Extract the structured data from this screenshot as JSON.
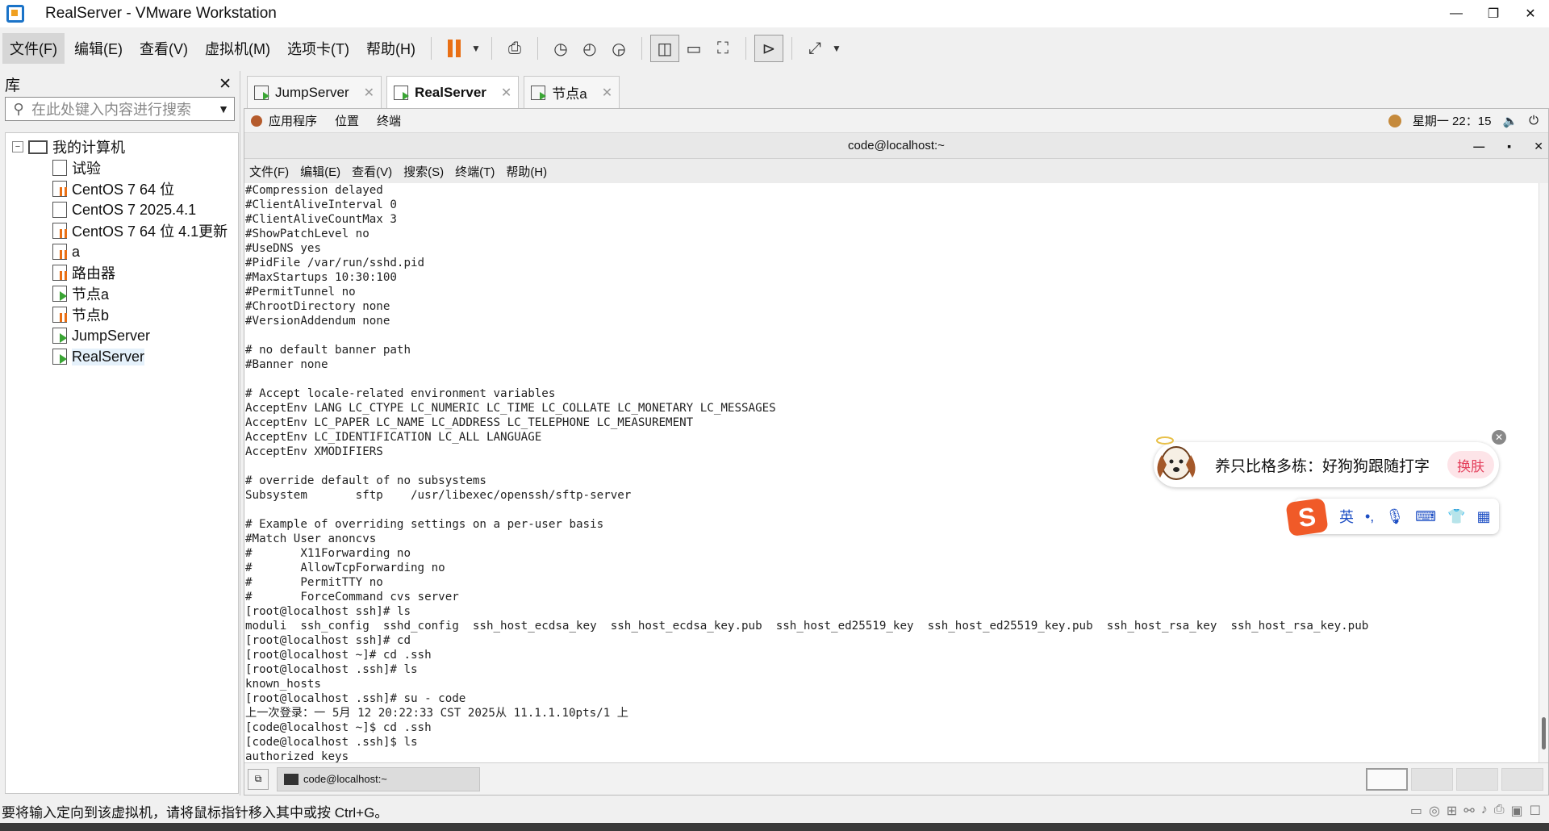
{
  "window": {
    "title": "RealServer - VMware Workstation",
    "controls": [
      "—",
      "❐",
      "✕"
    ]
  },
  "menubar": {
    "items": [
      "文件(F)",
      "编辑(E)",
      "查看(V)",
      "虚拟机(M)",
      "选项卡(T)",
      "帮助(H)"
    ]
  },
  "library": {
    "title": "库",
    "close": "✕",
    "search_placeholder": "在此处键入内容进行搜索",
    "root": "我的计算机",
    "vms": [
      {
        "name": "试验",
        "state": "off"
      },
      {
        "name": "CentOS 7 64 位",
        "state": "paused"
      },
      {
        "name": "CentOS 7 2025.4.1",
        "state": "off"
      },
      {
        "name": "CentOS 7 64 位 4.1更新",
        "state": "paused"
      },
      {
        "name": "a",
        "state": "paused"
      },
      {
        "name": "路由器",
        "state": "paused"
      },
      {
        "name": "节点a",
        "state": "running"
      },
      {
        "name": "节点b",
        "state": "paused"
      },
      {
        "name": "JumpServer",
        "state": "running"
      },
      {
        "name": "RealServer",
        "state": "running"
      }
    ]
  },
  "tabs": [
    {
      "label": "JumpServer",
      "active": false
    },
    {
      "label": "RealServer",
      "active": true
    },
    {
      "label": "节点a",
      "active": false
    }
  ],
  "gnome": {
    "menu": [
      "应用程序",
      "位置",
      "终端"
    ],
    "clock": "星期一 22：15"
  },
  "terminal": {
    "title": "code@localhost:~",
    "menu": [
      "文件(F)",
      "编辑(E)",
      "查看(V)",
      "搜索(S)",
      "终端(T)",
      "帮助(H)"
    ],
    "lines": [
      "#Compression delayed",
      "#ClientAliveInterval 0",
      "#ClientAliveCountMax 3",
      "#ShowPatchLevel no",
      "#UseDNS yes",
      "#PidFile /var/run/sshd.pid",
      "#MaxStartups 10:30:100",
      "#PermitTunnel no",
      "#ChrootDirectory none",
      "#VersionAddendum none",
      "",
      "# no default banner path",
      "#Banner none",
      "",
      "# Accept locale-related environment variables",
      "AcceptEnv LANG LC_CTYPE LC_NUMERIC LC_TIME LC_COLLATE LC_MONETARY LC_MESSAGES",
      "AcceptEnv LC_PAPER LC_NAME LC_ADDRESS LC_TELEPHONE LC_MEASUREMENT",
      "AcceptEnv LC_IDENTIFICATION LC_ALL LANGUAGE",
      "AcceptEnv XMODIFIERS",
      "",
      "# override default of no subsystems",
      "Subsystem       sftp    /usr/libexec/openssh/sftp-server",
      "",
      "# Example of overriding settings on a per-user basis",
      "#Match User anoncvs",
      "#       X11Forwarding no",
      "#       AllowTcpForwarding no",
      "#       PermitTTY no",
      "#       ForceCommand cvs server",
      "[root@localhost ssh]# ls",
      "moduli  ssh_config  sshd_config  ssh_host_ecdsa_key  ssh_host_ecdsa_key.pub  ssh_host_ed25519_key  ssh_host_ed25519_key.pub  ssh_host_rsa_key  ssh_host_rsa_key.pub",
      "[root@localhost ssh]# cd",
      "[root@localhost ~]# cd .ssh",
      "[root@localhost .ssh]# ls",
      "known_hosts",
      "[root@localhost .ssh]# su - code",
      "上一次登录：一 5月 12 20:22:33 CST 2025从 11.1.1.10pts/1 上",
      "[code@localhost ~]$ cd .ssh",
      "[code@localhost .ssh]$ ls",
      "authorized_keys"
    ]
  },
  "taskbar": {
    "task_label": "code@localhost:~"
  },
  "ime": {
    "popup_text": "养只比格多栋：好狗狗跟随打字",
    "swap_label": "换肤",
    "close": "✕",
    "logo": "S",
    "bar_lang": "英",
    "bar_punct": "•,"
  },
  "statusbar": {
    "message": "要将输入定向到该虚拟机，请将鼠标指针移入其中或按 Ctrl+G。"
  },
  "colors": {
    "pause_orange": "#e96f14",
    "run_green": "#3aa534",
    "sogou_orange": "#f05a28"
  }
}
